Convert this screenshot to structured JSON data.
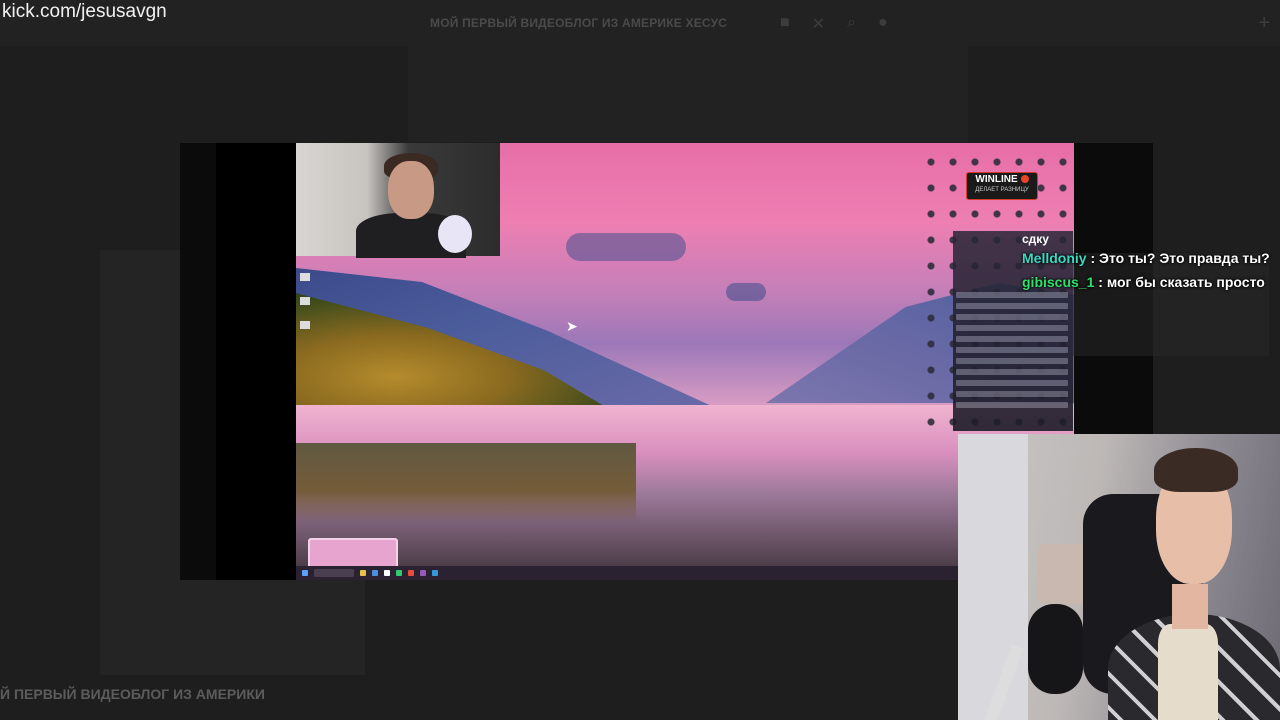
{
  "background_page": {
    "title": "МОЙ ПЕРВЫЙ ВИДЕОБЛОГ ИЗ АМЕРИКЕ ХЕСУС",
    "bottom_title": "Й ПЕРВЫЙ ВИДЕОБЛОГ ИЗ АМЕРИКИ",
    "icons": [
      "cam-icon",
      "close-icon",
      "search-icon",
      "mic-icon"
    ],
    "plus_icon": "+"
  },
  "overlay": {
    "url": "kick.com/jesusavgn"
  },
  "stream": {
    "sponsor_badge": {
      "brand": "WINLINE",
      "tagline": "ДЕЛАЕТ РАЗНИЦУ"
    }
  },
  "chat": {
    "partial_line": "сдку",
    "messages": [
      {
        "user": "Melldoniy",
        "text": ": Это ты? Это правда ты?",
        "user_color": "#39d9c2"
      },
      {
        "user": "gibiscus_1",
        "text": ": мог бы сказать просто",
        "user_color": "#2ee06a"
      }
    ]
  }
}
